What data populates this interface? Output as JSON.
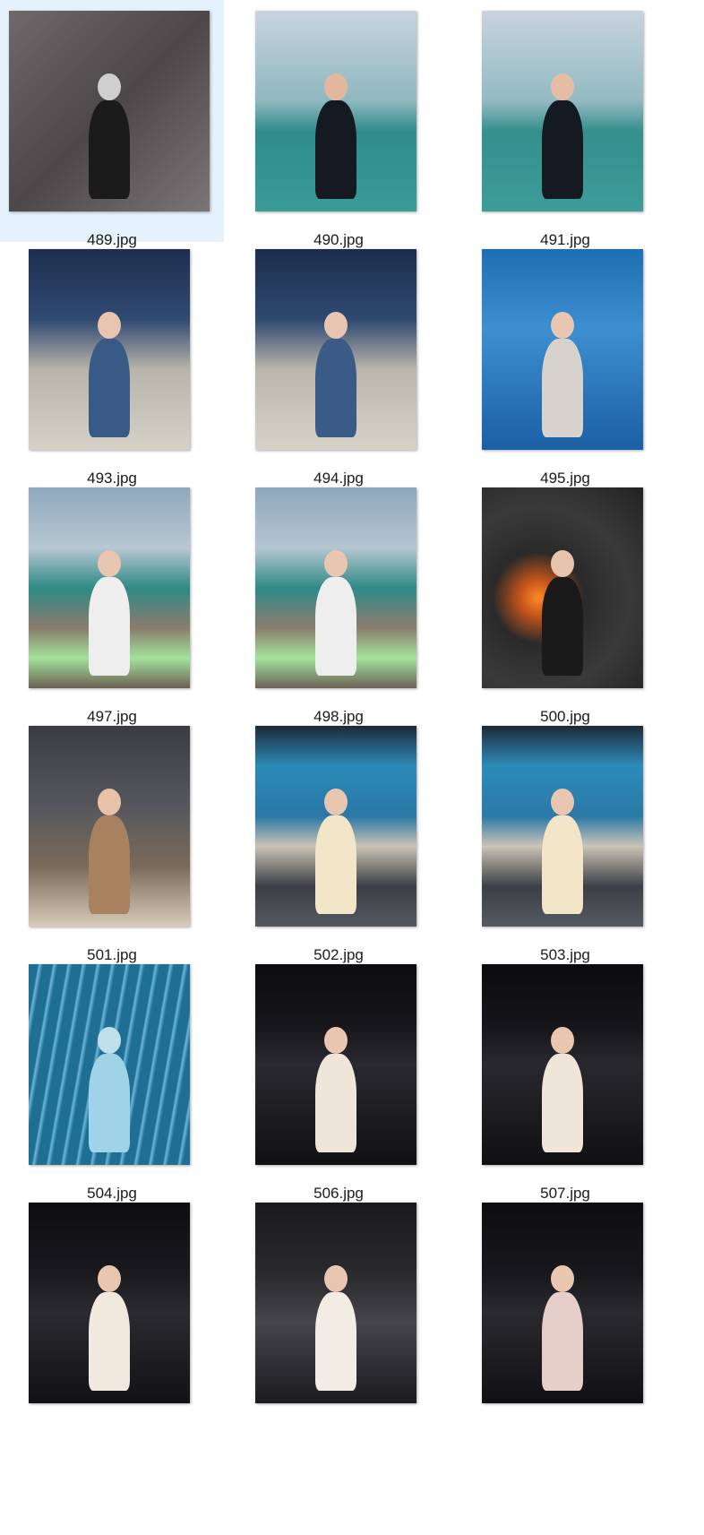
{
  "files": [
    {
      "name": "489.jpg",
      "selected": true,
      "bg": "linear-gradient(135deg,#6e6a6c 0%,#4c484a 50%,#7a7577 100%)",
      "fig": "#1b1b1b",
      "head": "#cfcfcf",
      "icon": "photo-bw-icon"
    },
    {
      "name": "490.jpg",
      "selected": false,
      "bg": "linear-gradient(180deg,#c9d4de 0%,#8fb7bf 45%,#2f8c8c 60%,#3a9b98 100%)",
      "fig": "#151a22",
      "head": "#e2b7a0",
      "icon": "photo-sea-icon"
    },
    {
      "name": "491.jpg",
      "selected": false,
      "bg": "linear-gradient(180deg,#c8d3dd 0%,#93bac2 45%,#348f8d 60%,#3d9c99 100%)",
      "fig": "#151a22",
      "head": "#e5bca4",
      "icon": "photo-sea-icon"
    },
    {
      "name": "493.jpg",
      "selected": false,
      "bg": "linear-gradient(180deg,#1d2e4e 0%,#314a72 35%,#b9b4aa 60%,#d6d1c7 100%)",
      "fig": "#3a5a86",
      "head": "#e7c5b0",
      "icon": "photo-globe-icon"
    },
    {
      "name": "494.jpg",
      "selected": false,
      "bg": "linear-gradient(180deg,#1c2d4d 0%,#304970 35%,#bab5ab 60%,#d7d2c8 100%)",
      "fig": "#3b5b87",
      "head": "#e7c5b0",
      "icon": "photo-globe-icon"
    },
    {
      "name": "495.jpg",
      "selected": false,
      "bg": "linear-gradient(180deg,#1d6fb3 0%,#3d8fd0 40%,#1a5fa3 100%)",
      "fig": "#d8d2cc",
      "head": "#e8c6b0",
      "icon": "photo-aquarium-icon"
    },
    {
      "name": "497.jpg",
      "selected": false,
      "bg": "linear-gradient(180deg,#8fa8bd 0%,#b7c7d2 30%,#2e8a86 50%,#8a7c6c 70%,#a0e39a 85%,#6d6055 100%)",
      "fig": "#eeeeee",
      "head": "#e8c6b0",
      "icon": "photo-resort-icon"
    },
    {
      "name": "498.jpg",
      "selected": false,
      "bg": "linear-gradient(180deg,#8ea7bc 0%,#b6c6d1 30%,#2f8b87 50%,#8b7d6d 70%,#a2e49c 85%,#6e6156 100%)",
      "fig": "#eeeeee",
      "head": "#e8c6b0",
      "icon": "photo-resort-icon"
    },
    {
      "name": "500.jpg",
      "selected": false,
      "bg": "radial-gradient(circle at 35% 55%,#ff8a2a 0%,#c4541a 12%,#2a2a2a 30%,#3a3a3a 60%,#222 100%)",
      "fig": "#1a1a1a",
      "head": "#e6c4ae",
      "icon": "photo-firepit-icon"
    },
    {
      "name": "501.jpg",
      "selected": false,
      "bg": "linear-gradient(180deg,#3a3c40 0%,#55575c 40%,#7a6a5a 70%,#d8cbb8 100%)",
      "fig": "#a8825e",
      "head": "#e6c2a8",
      "icon": "photo-birthday-icon"
    },
    {
      "name": "502.jpg",
      "selected": false,
      "bg": "linear-gradient(180deg,#1c2a38 0%,#2c8ab8 20%,#2a78a6 45%,#c9c2b5 60%,#3b3f45 80%,#55595f 100%)",
      "fig": "#f3e6c8",
      "head": "#e8c6b0",
      "icon": "photo-restaurant-icon"
    },
    {
      "name": "503.jpg",
      "selected": false,
      "bg": "linear-gradient(180deg,#1c2a38 0%,#2d8bb9 20%,#2b79a7 45%,#cac3b6 60%,#3c4046 80%,#565a60 100%)",
      "fig": "#f3e6c8",
      "head": "#e8c6b0",
      "icon": "photo-restaurant-icon"
    },
    {
      "name": "504.jpg",
      "selected": false,
      "bg": "repeating-linear-gradient(100deg,#1f6f95 0px,#1f6f95 10px,#6fb6d8 12px,#1f6f95 16px)",
      "fig": "#9fd3e8",
      "head": "#bfe0ea",
      "icon": "photo-blue-hall-icon"
    },
    {
      "name": "506.jpg",
      "selected": false,
      "bg": "linear-gradient(180deg,#0d0d10 0%,#16161a 30%,#2a2a2e 50%,#111114 100%)",
      "fig": "#efe5d8",
      "head": "#e8c6b0",
      "icon": "photo-dark-room-icon"
    },
    {
      "name": "507.jpg",
      "selected": false,
      "bg": "linear-gradient(180deg,#0c0c0f 0%,#151519 30%,#29292d 50%,#101013 100%)",
      "fig": "#efe5d8",
      "head": "#e8c6b0",
      "icon": "photo-dark-room-icon"
    },
    {
      "name": "",
      "selected": false,
      "bg": "linear-gradient(180deg,#0e0e11 0%,#1a1a1e 35%,#2b2b2f 55%,#121215 100%)",
      "fig": "#f1e9de",
      "head": "#e8c6b0",
      "icon": "photo-dark-room-icon"
    },
    {
      "name": "",
      "selected": false,
      "bg": "linear-gradient(180deg,#1a1a1d 0%,#2a2a2d 35%,#45454a 60%,#1c1c1f 100%)",
      "fig": "#f2ece4",
      "head": "#e8c6b0",
      "icon": "photo-cake-icon"
    },
    {
      "name": "",
      "selected": false,
      "bg": "linear-gradient(180deg,#0d0d10 0%,#18181c 35%,#2a2a2e 55%,#111114 100%)",
      "fig": "#e6cfc9",
      "head": "#e8c6b0",
      "icon": "photo-group-icon"
    }
  ]
}
